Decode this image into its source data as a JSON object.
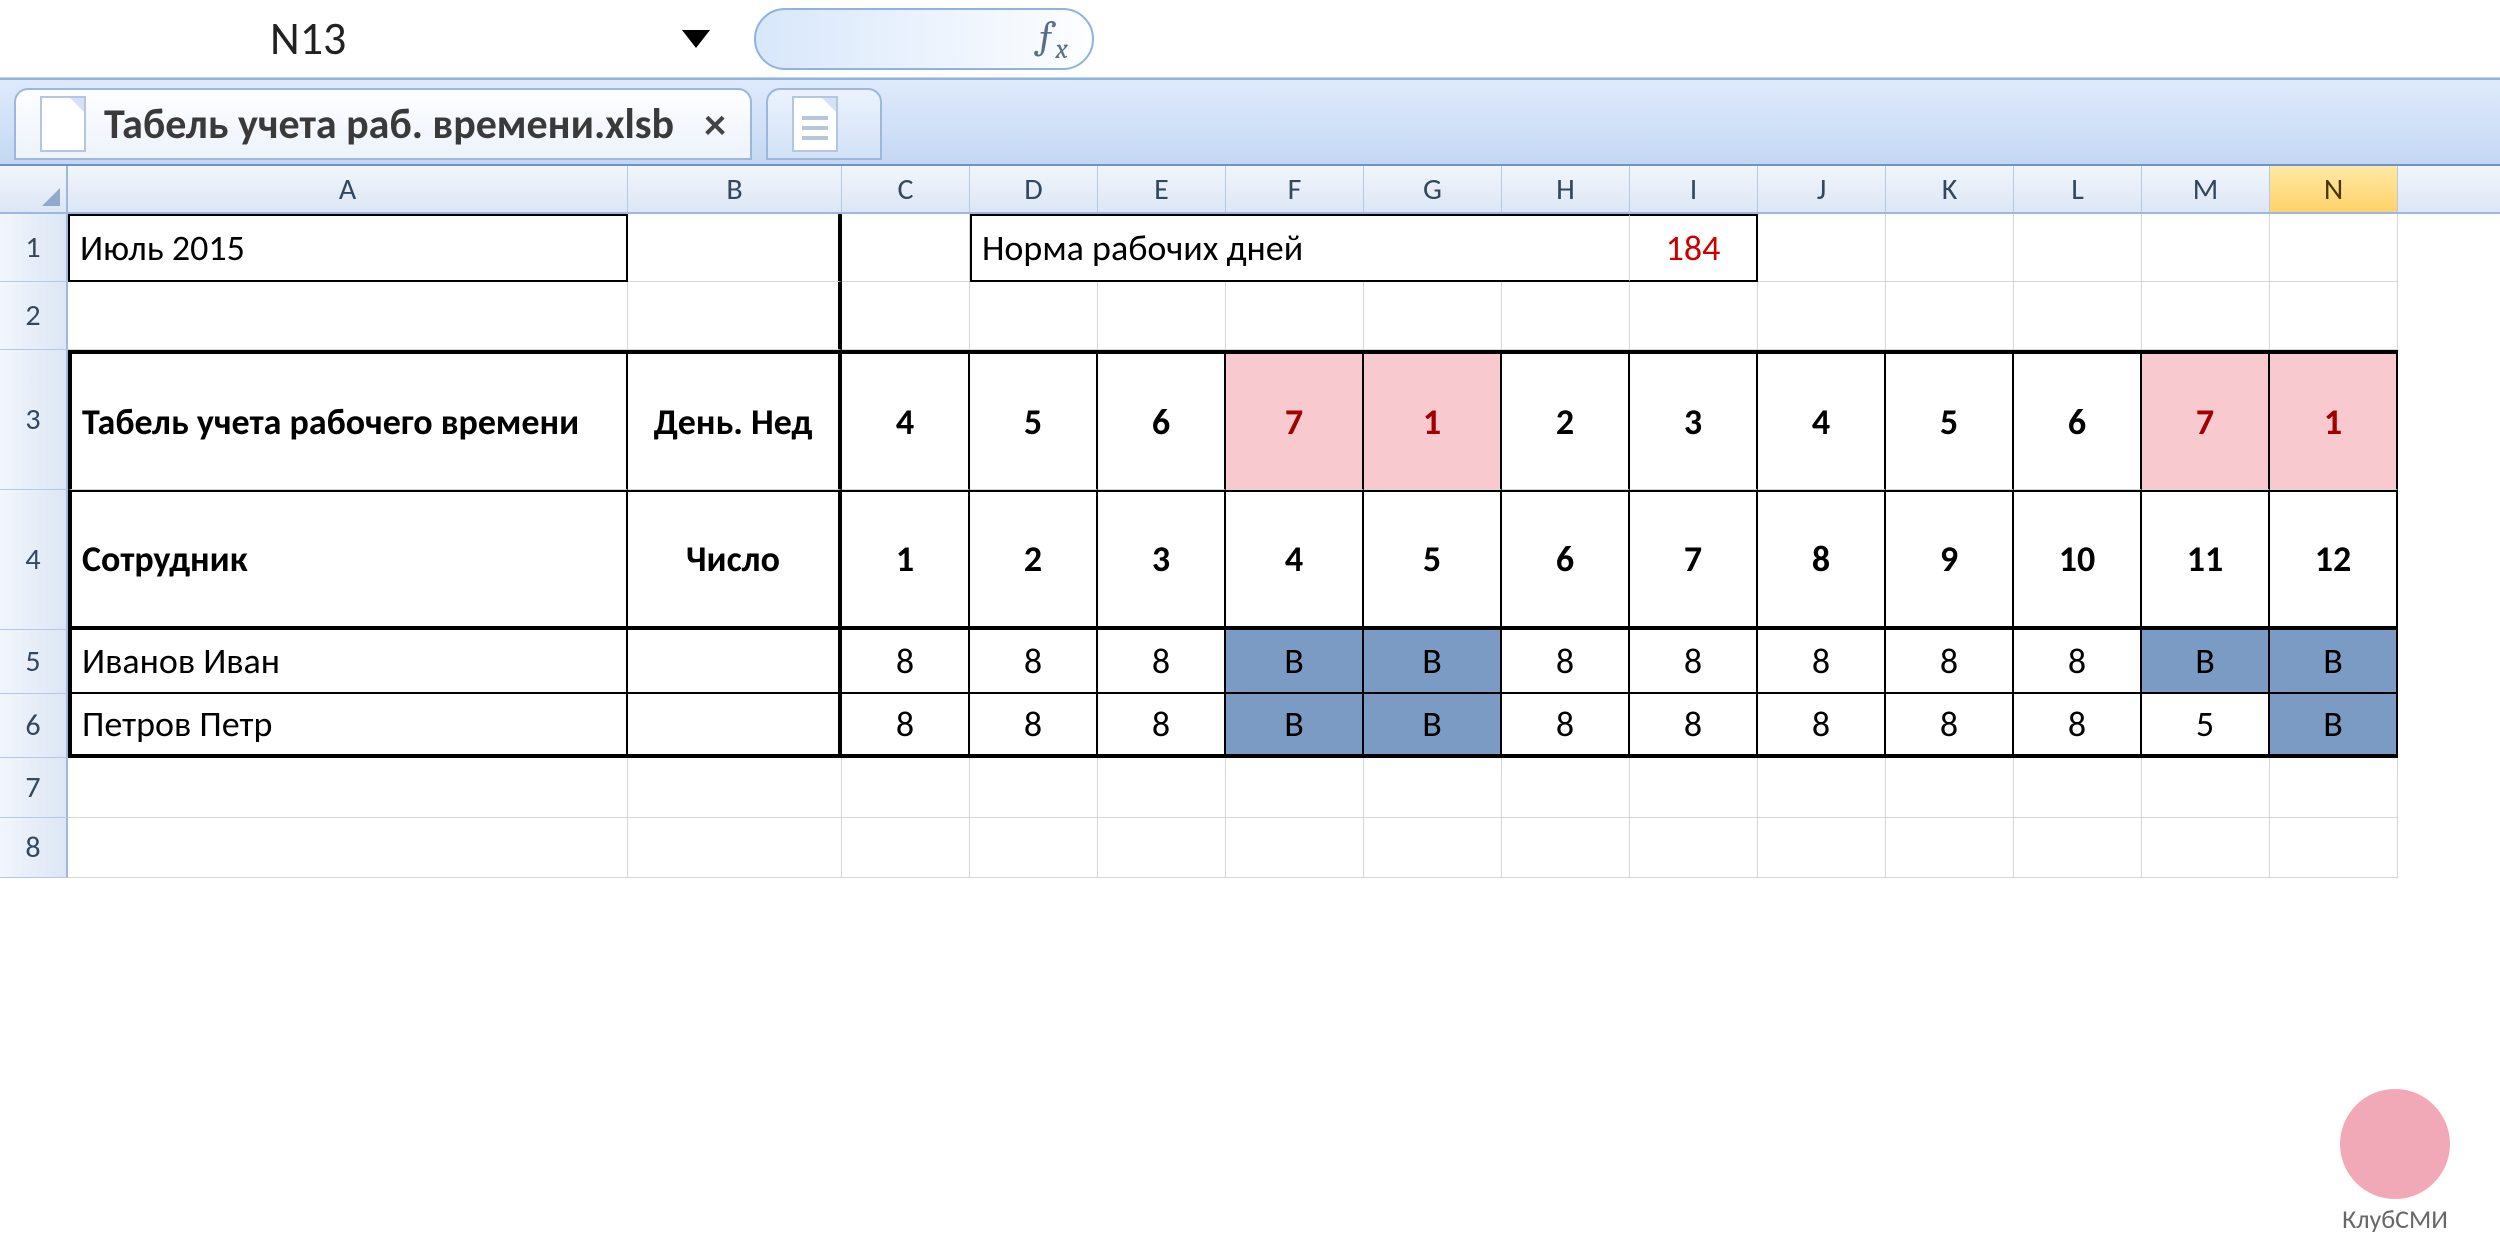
{
  "formula_bar": {
    "cell_ref": "N13",
    "fx_label": "ƒx"
  },
  "tabs": {
    "active_title": "Табель учета раб. времени.xlsb"
  },
  "columns": [
    "A",
    "B",
    "C",
    "D",
    "E",
    "F",
    "G",
    "H",
    "I",
    "J",
    "K",
    "L",
    "M",
    "N"
  ],
  "col_classes": [
    "cA",
    "cB",
    "cC",
    "cD",
    "cE",
    "cF",
    "cG",
    "cH",
    "cI",
    "cJ",
    "cK",
    "cL",
    "cM",
    "cN"
  ],
  "selected_col": "N",
  "row_numbers": [
    "1",
    "2",
    "3",
    "4",
    "5",
    "6",
    "7",
    "8"
  ],
  "sheet": {
    "period": "Июль 2015",
    "norm_label": "Норма рабочих дней",
    "norm_value": "184",
    "header_title": "Табель учета рабочего времени",
    "day_of_week_label": "День. Нед",
    "employee_label": "Сотрудник",
    "date_label": "Число",
    "weekdays": [
      "4",
      "5",
      "6",
      "7",
      "1",
      "2",
      "3",
      "4",
      "5",
      "6",
      "7",
      "1"
    ],
    "weekday_weekend": [
      false,
      false,
      false,
      true,
      true,
      false,
      false,
      false,
      false,
      false,
      true,
      true
    ],
    "dates": [
      "1",
      "2",
      "3",
      "4",
      "5",
      "6",
      "7",
      "8",
      "9",
      "10",
      "11",
      "12"
    ],
    "rows": [
      {
        "name": "Иванов Иван",
        "vals": [
          "8",
          "8",
          "8",
          "В",
          "В",
          "8",
          "8",
          "8",
          "8",
          "8",
          "В",
          "В"
        ],
        "weekend": [
          false,
          false,
          false,
          true,
          true,
          false,
          false,
          false,
          false,
          false,
          true,
          true
        ]
      },
      {
        "name": "Петров Петр",
        "vals": [
          "8",
          "8",
          "8",
          "В",
          "В",
          "8",
          "8",
          "8",
          "8",
          "8",
          "5",
          "В"
        ],
        "weekend": [
          false,
          false,
          false,
          true,
          true,
          false,
          false,
          false,
          false,
          false,
          false,
          true
        ]
      }
    ]
  },
  "watermark": "КлубСМИ"
}
